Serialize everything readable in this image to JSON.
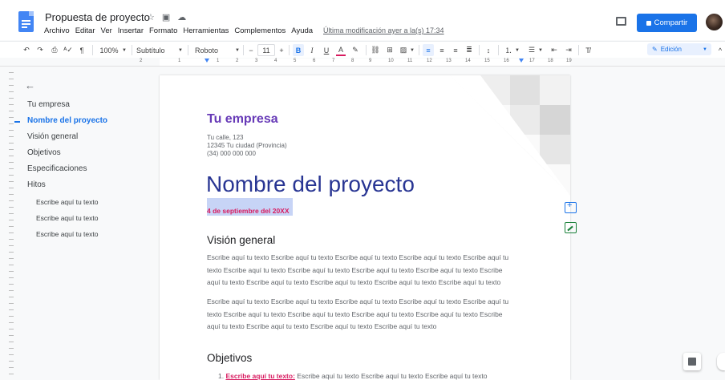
{
  "header": {
    "doc_title": "Propuesta de proyecto",
    "last_edit": "Última modificación ayer a la(s) 17:34",
    "share_label": "Compartir",
    "menus": [
      "Archivo",
      "Editar",
      "Ver",
      "Insertar",
      "Formato",
      "Herramientas",
      "Complementos",
      "Ayuda"
    ]
  },
  "toolbar": {
    "zoom": "100%",
    "style": "Subtítulo",
    "font": "Roboto",
    "font_size": "11",
    "minus": "−",
    "plus": "+",
    "bold": "B",
    "italic": "I",
    "underline": "U",
    "text_color": "A",
    "edit_mode": "Edición",
    "accent": "#1a73e8"
  },
  "ruler": {
    "numbers": [
      "2",
      "1",
      "1",
      "2",
      "3",
      "4",
      "5",
      "6",
      "7",
      "8",
      "9",
      "10",
      "11",
      "12",
      "13",
      "14",
      "15",
      "16",
      "17",
      "18",
      "19"
    ]
  },
  "outline": {
    "items": [
      {
        "label": "Tu empresa",
        "level": 1,
        "active": false
      },
      {
        "label": "Nombre del proyecto",
        "level": 1,
        "active": true
      },
      {
        "label": "Visión general",
        "level": 1,
        "active": false
      },
      {
        "label": "Objetivos",
        "level": 1,
        "active": false
      },
      {
        "label": "Especificaciones",
        "level": 1,
        "active": false
      },
      {
        "label": "Hitos",
        "level": 1,
        "active": false
      },
      {
        "label": "Escribe aquí tu texto",
        "level": 2,
        "active": false
      },
      {
        "label": "Escribe aquí tu texto",
        "level": 2,
        "active": false
      },
      {
        "label": "Escribe aquí tu texto",
        "level": 2,
        "active": false
      }
    ]
  },
  "document": {
    "company": "Tu empresa",
    "address": [
      "Tu calle, 123",
      "12345 Tu ciudad (Provincia)",
      "(34) 000 000 000"
    ],
    "project_title": "Nombre del proyecto",
    "date": "4 de septiembre del 20XX",
    "section_overview": "Visión general",
    "para1": "Escribe aquí tu texto Escribe aquí tu texto Escribe aquí tu texto Escribe aquí tu texto Escribe aquí tu texto Escribe aquí tu texto Escribe aquí tu texto Escribe aquí tu texto Escribe aquí tu texto Escribe aquí tu texto Escribe aquí tu texto Escribe aquí tu texto Escribe aquí tu texto Escribe aquí tu texto",
    "para2": "Escribe aquí tu texto Escribe aquí tu texto Escribe aquí tu texto Escribe aquí tu texto Escribe aquí tu texto Escribe aquí tu texto Escribe aquí tu texto Escribe aquí tu texto Escribe aquí tu texto Escribe aquí tu texto Escribe aquí tu texto Escribe aquí tu texto Escribe aquí tu texto",
    "section_goals": "Objetivos",
    "list_number": "1.",
    "list_lead": "Escribe aquí tu texto:",
    "list_rest": "Escribe aquí tu texto Escribe aquí tu texto Escribe aquí tu texto"
  },
  "colors": {
    "company": "#673ab7",
    "title": "#283593",
    "date": "#d81b60",
    "highlight": "#c7d4f6"
  }
}
